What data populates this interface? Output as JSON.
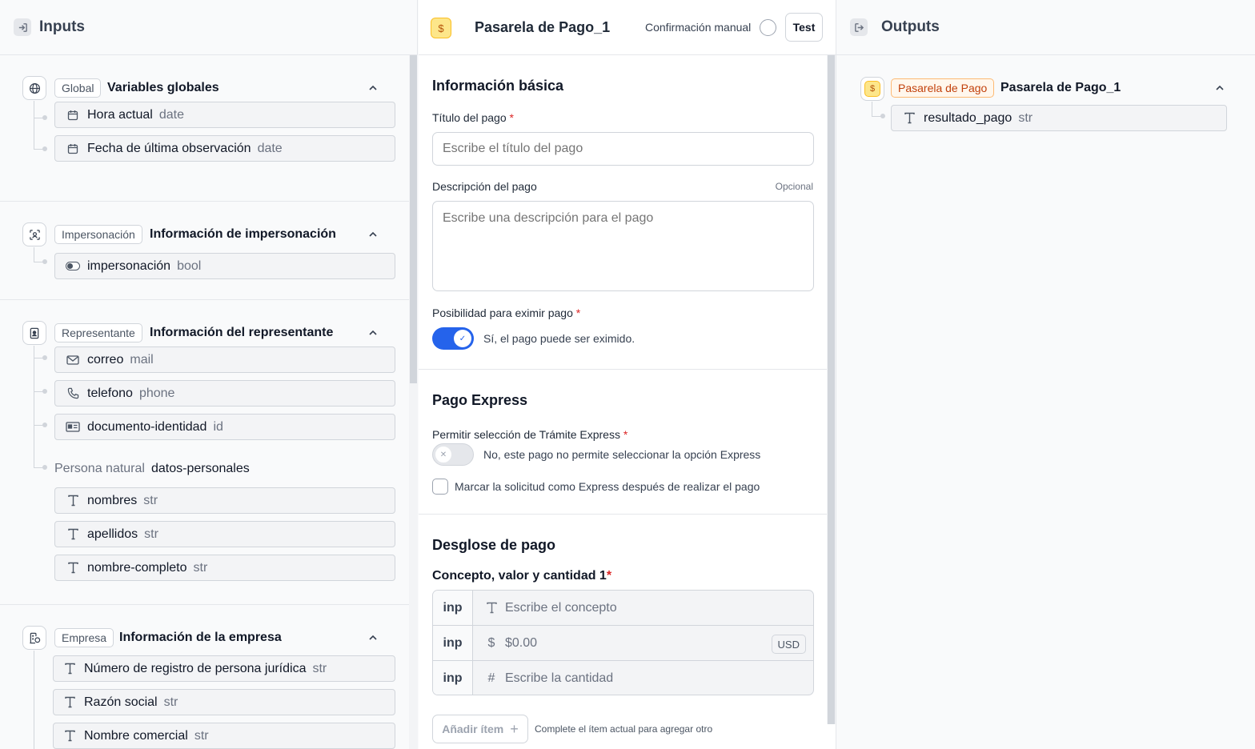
{
  "inputs_panel": {
    "title": "Inputs",
    "groups": [
      {
        "badge": "Global",
        "title": "Variables globales",
        "fields": [
          {
            "name": "Hora actual",
            "type": "date"
          },
          {
            "name": "Fecha de última observación",
            "type": "date"
          }
        ]
      },
      {
        "badge": "Impersonación",
        "title": "Información de impersonación",
        "fields": [
          {
            "name": "impersonación",
            "type": "bool"
          }
        ]
      },
      {
        "badge": "Representante",
        "title": "Información del representante",
        "fields": [
          {
            "name": "correo",
            "type": "mail"
          },
          {
            "name": "telefono",
            "type": "phone"
          },
          {
            "name": "documento-identidad",
            "type": "id"
          }
        ],
        "sub": {
          "label": "Persona natural",
          "key": "datos-personales",
          "fields": [
            {
              "name": "nombres",
              "type": "str"
            },
            {
              "name": "apellidos",
              "type": "str"
            },
            {
              "name": "nombre-completo",
              "type": "str"
            }
          ]
        }
      },
      {
        "badge": "Empresa",
        "title": "Información de la empresa",
        "fields": [
          {
            "name": "Número de registro de persona jurídica",
            "type": "str"
          },
          {
            "name": "Razón social",
            "type": "str"
          },
          {
            "name": "Nombre comercial",
            "type": "str"
          }
        ]
      }
    ]
  },
  "config_panel": {
    "node_title": "Pasarela de Pago_1",
    "manual_confirm_label": "Confirmación manual",
    "test_label": "Test",
    "basic": {
      "title": "Información básica",
      "title_label": "Título del pago",
      "title_placeholder": "Escribe el título del pago",
      "desc_label": "Descripción del pago",
      "desc_optional": "Opcional",
      "desc_placeholder": "Escribe una descripción para el pago",
      "exempt_label": "Posibilidad para eximir pago",
      "exempt_text": "Sí, el pago puede ser eximido."
    },
    "express": {
      "title": "Pago Express",
      "allow_label": "Permitir selección de Trámite Express",
      "allow_text": "No, este pago no permite seleccionar la opción Express",
      "mark_text": "Marcar la solicitud como Express después de realizar el pago"
    },
    "breakdown": {
      "title": "Desglose de pago",
      "item_label": "Concepto, valor y cantidad 1",
      "rows": [
        {
          "prefix": "inp",
          "placeholder": "Escribe el concepto"
        },
        {
          "prefix": "inp",
          "placeholder": "$0.00",
          "currency": "USD"
        },
        {
          "prefix": "inp",
          "placeholder": "Escribe la cantidad"
        }
      ],
      "add_label": "Añadir ítem",
      "add_hint": "Complete el ítem actual para agregar otro"
    }
  },
  "outputs_panel": {
    "title": "Outputs",
    "node_badge": "Pasarela de Pago",
    "node_title": "Pasarela de Pago_1",
    "fields": [
      {
        "name": "resultado_pago",
        "type": "str"
      }
    ]
  },
  "colors": {
    "accent": "#2563eb",
    "payment_badge": "#c2410c",
    "required": "#dc2626"
  }
}
